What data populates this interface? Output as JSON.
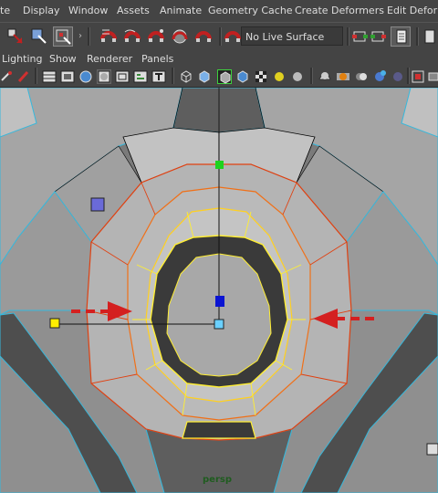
{
  "menubar": {
    "items": [
      "te",
      "Display",
      "Window",
      "Assets",
      "Animate",
      "Geometry Cache",
      "Create Deformers",
      "Edit Deformers"
    ]
  },
  "toolbar": {
    "live_surface_label": "No Live Surface",
    "icons": [
      "select-by-hierarchy-icon",
      "select-by-object-type-icon",
      "select-by-component-type-icon",
      "snap-to-grid-icon",
      "snap-to-curve-icon",
      "snap-to-point-icon",
      "snap-to-view-plane-icon",
      "make-live-icon",
      "input-ops-icon",
      "output-ops-icon",
      "render-settings-icon",
      "ipr-render-icon"
    ]
  },
  "panel_menu": {
    "items": [
      "Lighting",
      "Show",
      "Renderer",
      "Panels"
    ]
  },
  "viewport": {
    "camera_label": "persp",
    "colors": {
      "surface": "#a9a9a9",
      "wire": "#36b8dc",
      "selected_edges": "#ffee33",
      "soft_select": "#e04010",
      "arrow": "#d42020",
      "manip_green": "#1ed21e",
      "manip_blue": "#0a14d2",
      "manip_yellow": "#ffee00"
    }
  }
}
